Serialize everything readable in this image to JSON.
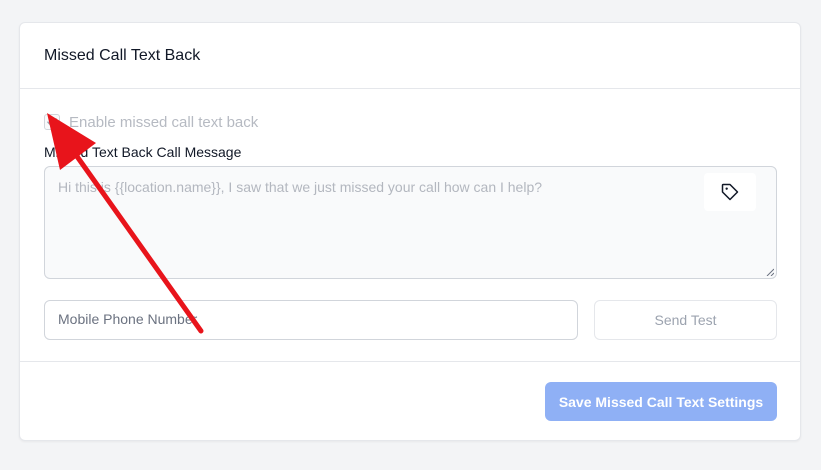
{
  "card": {
    "title": "Missed Call Text Back"
  },
  "enable_checkbox": {
    "label": "Enable missed call text back",
    "checked": true
  },
  "message_field": {
    "label": "Missed Text Back Call Message",
    "placeholder": "Hi this is {{location.name}}, I saw that we just missed your call how can I help?"
  },
  "phone_field": {
    "placeholder": "Mobile Phone Number"
  },
  "buttons": {
    "send_test": "Send Test",
    "save": "Save Missed Call Text Settings"
  },
  "colors": {
    "primary_button": "#8fb0f5",
    "annotation_arrow": "#e8141b"
  },
  "icons": {
    "checkbox": "check-icon",
    "tag": "tag-icon"
  }
}
